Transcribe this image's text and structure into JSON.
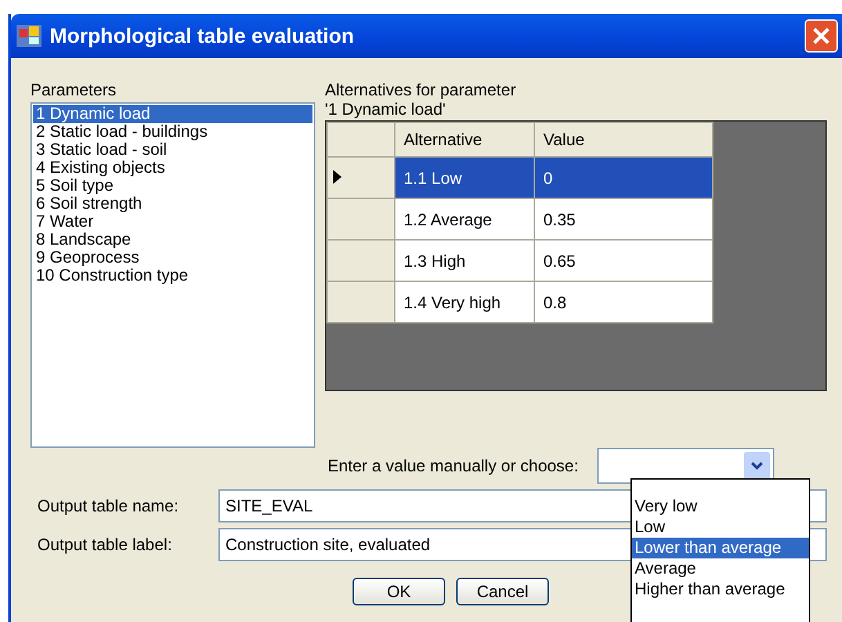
{
  "window": {
    "title": "Morphological table evaluation"
  },
  "parameters": {
    "label": "Parameters",
    "items": [
      {
        "label": "1 Dynamic load",
        "selected": true
      },
      {
        "label": "2 Static load - buildings",
        "selected": false
      },
      {
        "label": "3 Static load - soil",
        "selected": false
      },
      {
        "label": "4 Existing objects",
        "selected": false
      },
      {
        "label": "5 Soil type",
        "selected": false
      },
      {
        "label": "6 Soil strength",
        "selected": false
      },
      {
        "label": "7 Water",
        "selected": false
      },
      {
        "label": "8 Landscape",
        "selected": false
      },
      {
        "label": "9 Geoprocess",
        "selected": false
      },
      {
        "label": "10 Construction type",
        "selected": false
      }
    ]
  },
  "alternatives": {
    "label": "Alternatives for parameter",
    "parameter": "'1 Dynamic load'",
    "columns": [
      "Alternative",
      "Value"
    ],
    "rows": [
      {
        "alternative": "1.1 Low",
        "value": "0",
        "selected": true
      },
      {
        "alternative": "1.2 Average",
        "value": "0.35",
        "selected": false
      },
      {
        "alternative": "1.3 High",
        "value": "0.65",
        "selected": false
      },
      {
        "alternative": "1.4 Very high",
        "value": "0.8",
        "selected": false
      }
    ]
  },
  "choose": {
    "label": "Enter a value manually or choose:",
    "options": [
      {
        "label": "Very low",
        "selected": false
      },
      {
        "label": "Low",
        "selected": false
      },
      {
        "label": "Lower than average",
        "selected": true
      },
      {
        "label": "Average",
        "selected": false
      },
      {
        "label": "Higher than average",
        "selected": false
      }
    ]
  },
  "output_name": {
    "label": "Output table name:",
    "value": "SITE_EVAL"
  },
  "output_label": {
    "label": "Output table label:",
    "value": "Construction site, evaluated"
  },
  "buttons": [
    "OK",
    "Cancel"
  ]
}
